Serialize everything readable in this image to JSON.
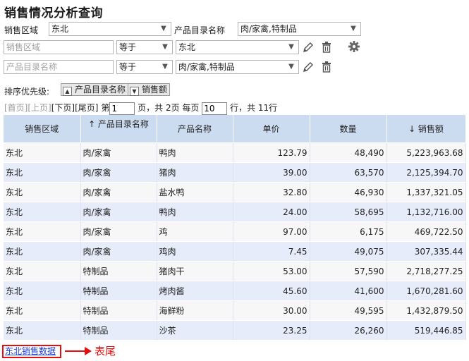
{
  "title": "销售情况分析查询",
  "filter1": {
    "region_label": "销售区域",
    "region_value": "东北",
    "catalog_label": "产品目录名称",
    "catalog_value": "肉/家禽,特制品"
  },
  "condition_rows": [
    {
      "field_placeholder": "销售区域",
      "operator": "等于",
      "value": "东北"
    },
    {
      "field_placeholder": "产品目录名称",
      "operator": "等于",
      "value": "肉/家禽,特制品"
    }
  ],
  "sort": {
    "label": "排序优先级:",
    "items": [
      {
        "label": "产品目录名称",
        "direction": "up"
      },
      {
        "label": "销售额",
        "direction": "down"
      }
    ]
  },
  "pager": {
    "first": "[首页]",
    "prev": "[上页]",
    "next": "[下页]",
    "last": "[尾页]",
    "page_prefix": "第",
    "current_page": "1",
    "page_suffix": "页，共 2页 每页",
    "page_size": "10",
    "rows_suffix": "行，共 11行"
  },
  "table": {
    "headers": [
      "销售区域",
      "↑ 产品目录名称",
      "产品名称",
      "单价",
      "数量",
      "↓ 销售额"
    ],
    "rows": [
      [
        "东北",
        "肉/家禽",
        "鸭肉",
        "123.79",
        "48,490",
        "5,223,963.68"
      ],
      [
        "东北",
        "肉/家禽",
        "猪肉",
        "39.00",
        "63,570",
        "2,125,394.70"
      ],
      [
        "东北",
        "肉/家禽",
        "盐水鸭",
        "32.80",
        "46,930",
        "1,337,321.05"
      ],
      [
        "东北",
        "肉/家禽",
        "鸭肉",
        "24.00",
        "58,695",
        "1,132,716.00"
      ],
      [
        "东北",
        "肉/家禽",
        "鸡",
        "97.00",
        "6,175",
        "469,722.50"
      ],
      [
        "东北",
        "肉/家禽",
        "鸡肉",
        "7.45",
        "49,075",
        "307,335.44"
      ],
      [
        "东北",
        "特制品",
        "猪肉干",
        "53.00",
        "57,590",
        "2,718,277.25"
      ],
      [
        "东北",
        "特制品",
        "烤肉酱",
        "45.60",
        "41,600",
        "1,670,281.60"
      ],
      [
        "东北",
        "特制品",
        "海鲜粉",
        "30.00",
        "49,595",
        "1,432,879.50"
      ],
      [
        "东北",
        "特制品",
        "沙茶",
        "23.25",
        "26,260",
        "519,446.85"
      ]
    ]
  },
  "footer": {
    "link_text": "东北销售数据",
    "annotation": "表尾"
  },
  "icons": {
    "dropdown": "chevron-down-icon",
    "edit": "pencil-icon",
    "delete": "trash-icon",
    "settings": "gear-icon"
  },
  "colors": {
    "header_bg": "#ccdcf0",
    "row_alt_bg": "#e6ecfa",
    "annotation_red": "#e01010",
    "link_blue": "#1a3fd6"
  }
}
